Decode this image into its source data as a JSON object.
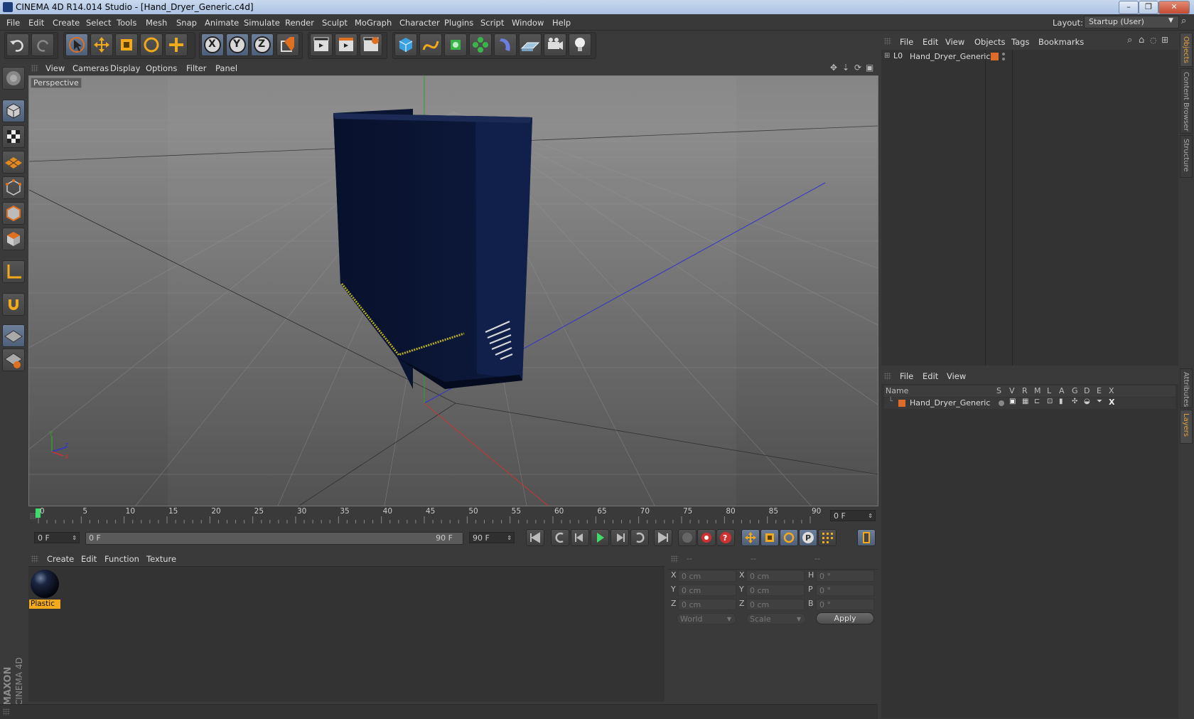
{
  "window": {
    "title": "CINEMA 4D R14.014 Studio - [Hand_Dryer_Generic.c4d]",
    "minimize": "–",
    "maximize": "❐",
    "close": "✕"
  },
  "menubar": {
    "items": [
      "File",
      "Edit",
      "Create",
      "Select",
      "Tools",
      "Mesh",
      "Snap",
      "Animate",
      "Simulate",
      "Render",
      "Sculpt",
      "MoGraph",
      "Character",
      "Plugins",
      "Script",
      "Window",
      "Help"
    ],
    "layout_label": "Layout:",
    "layout_value": "Startup (User)"
  },
  "toolbar": {
    "icons": [
      "undo-icon",
      "redo-icon",
      "live-selection-icon",
      "move-icon",
      "scale-icon",
      "rotate-icon",
      "add-icon",
      "x-axis-icon",
      "y-axis-icon",
      "z-axis-icon",
      "coordinate-system-icon",
      "render-view-icon",
      "render-picture-viewer-icon",
      "render-settings-icon",
      "cube-icon",
      "spline-icon",
      "nurbs-icon",
      "array-icon",
      "deformer-icon",
      "floor-icon",
      "camera-icon",
      "light-icon"
    ],
    "axis_x": "X",
    "axis_y": "Y",
    "axis_z": "Z"
  },
  "viewport": {
    "menu": [
      "View",
      "Cameras",
      "Display",
      "Options",
      "Filter",
      "Panel"
    ],
    "label": "Perspective",
    "colors": {
      "background": "#6b6b6b",
      "object": "#0a1433",
      "stripe": "#b8b021"
    }
  },
  "timeline": {
    "ticks": [
      "0",
      "5",
      "10",
      "15",
      "20",
      "25",
      "30",
      "35",
      "40",
      "45",
      "50",
      "55",
      "60",
      "65",
      "70",
      "75",
      "80",
      "85",
      "90"
    ],
    "current_frame": "0 F"
  },
  "transport": {
    "start_field": "0 F",
    "range_start": "0 F",
    "range_end": "90 F",
    "end_field": "90 F"
  },
  "material_manager": {
    "menu": [
      "Create",
      "Edit",
      "Function",
      "Texture"
    ],
    "materials": [
      {
        "name": "Plastic"
      }
    ]
  },
  "coordinates": {
    "headers": [
      "--",
      "--",
      "--"
    ],
    "rows": [
      {
        "l1": "X",
        "v1": "0 cm",
        "l2": "X",
        "v2": "0 cm",
        "l3": "H",
        "v3": "0 °"
      },
      {
        "l1": "Y",
        "v1": "0 cm",
        "l2": "Y",
        "v2": "0 cm",
        "l3": "P",
        "v3": "0 °"
      },
      {
        "l1": "Z",
        "v1": "0 cm",
        "l2": "Z",
        "v2": "0 cm",
        "l3": "B",
        "v3": "0 °"
      }
    ],
    "mode": "World",
    "transform": "Scale",
    "apply": "Apply"
  },
  "object_manager": {
    "menu": [
      "File",
      "Edit",
      "View",
      "Objects",
      "Tags",
      "Bookmarks"
    ],
    "objects": [
      {
        "name": "Hand_Dryer_Generic"
      }
    ]
  },
  "layer_manager": {
    "menu": [
      "File",
      "Edit",
      "View"
    ],
    "columns": [
      "Name",
      "S",
      "V",
      "R",
      "M",
      "L",
      "A",
      "G",
      "D",
      "E",
      "X"
    ],
    "layers": [
      {
        "name": "Hand_Dryer_Generic"
      }
    ]
  },
  "side_tabs": {
    "objects": "Objects",
    "content_browser": "Content Browser",
    "structure": "Structure",
    "attributes": "Attributes",
    "layers": "Layers"
  },
  "branding": {
    "maxon": "MAXON",
    "cinema": "CINEMA 4D"
  }
}
